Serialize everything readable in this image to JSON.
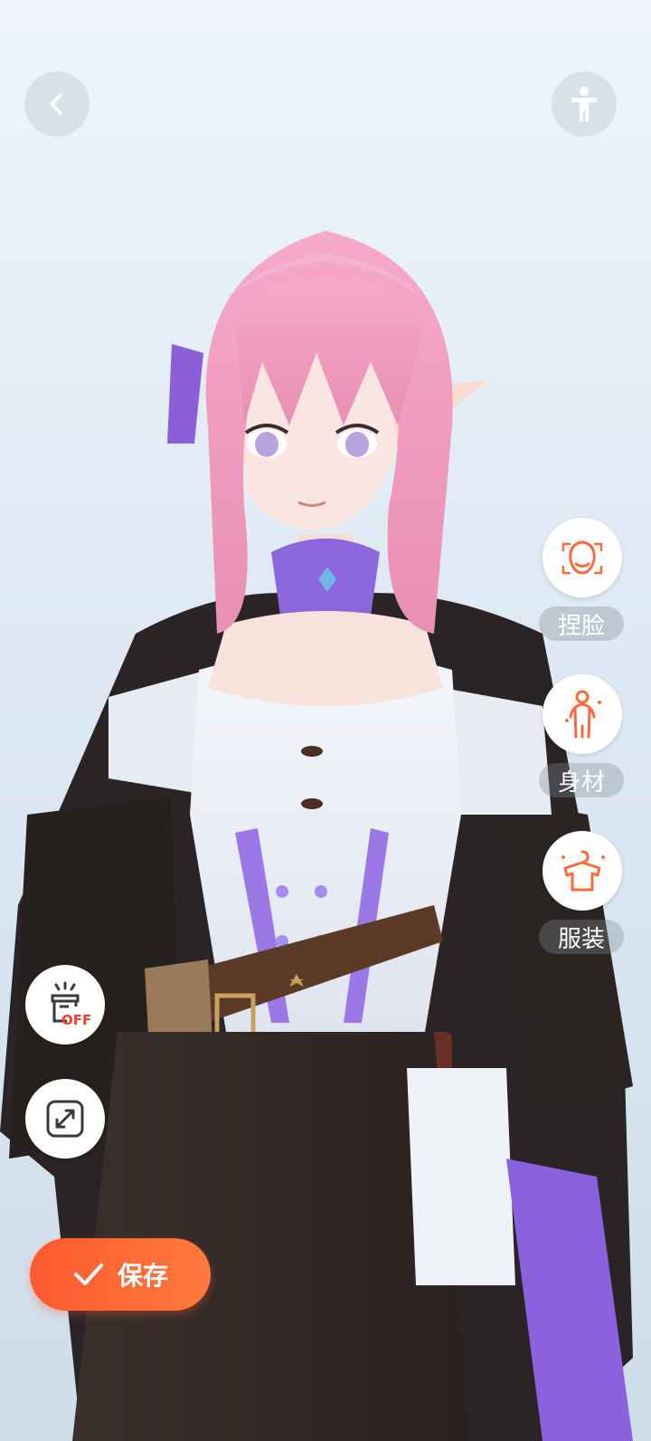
{
  "top_bar": {
    "back_icon": "chevron-left-icon",
    "pose_icon": "standing-person-icon"
  },
  "side_menu": {
    "items": [
      {
        "label": "捏脸",
        "icon": "face-icon"
      },
      {
        "label": "身材",
        "icon": "body-icon"
      },
      {
        "label": "服装",
        "icon": "hanger-shirt-icon"
      }
    ]
  },
  "left_tools": {
    "hide_outfit_icon": "outfit-toggle-icon",
    "hide_outfit_badge": "OFF",
    "expand_icon": "expand-icon"
  },
  "save_button": {
    "label": "保存",
    "icon": "check-icon"
  },
  "colors": {
    "accent": "#ff5e31",
    "icon_orange": "#ff6a3a"
  }
}
